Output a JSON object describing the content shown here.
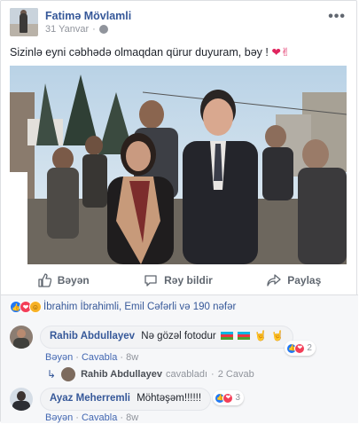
{
  "post": {
    "author": "Fatimə Mövlamli",
    "date": "31 Yanvar",
    "privacy_icon": "globe-icon",
    "text": "Sizinlə eyni cəbhədə olmaqdan qürur duyuram, bəy !",
    "text_emoji": "❤✌",
    "more_icon": "•••"
  },
  "actions": {
    "like_label": "Bəyən",
    "comment_label": "Rəy bildir",
    "share_label": "Paylaş"
  },
  "reactions": {
    "summary": "İbrahim İbrahimli, Emil Cəfərli və 190 nəfər",
    "types": [
      "like-icon",
      "love-icon",
      "haha-icon"
    ]
  },
  "comments": [
    {
      "author": "Rahib Abdullayev",
      "text": "Nə gözəl fotodur",
      "reaction_count": "2",
      "like_label": "Bəyən",
      "reply_label": "Cavabla",
      "time": "8w",
      "reply_summary": {
        "author": "Rahib Abdullayev",
        "verb": "cavabladı",
        "count": "2 Cavab"
      }
    },
    {
      "author": "Ayaz Meherremli",
      "text": "Möhtəşəm!!!!!!",
      "reaction_count": "3",
      "like_label": "Bəyən",
      "reply_label": "Cavabla",
      "time": "8w"
    }
  ],
  "colors": {
    "link": "#365899",
    "muted": "#90949c",
    "like": "#2078f4",
    "love": "#f33e58",
    "haha": "#f7b125"
  }
}
